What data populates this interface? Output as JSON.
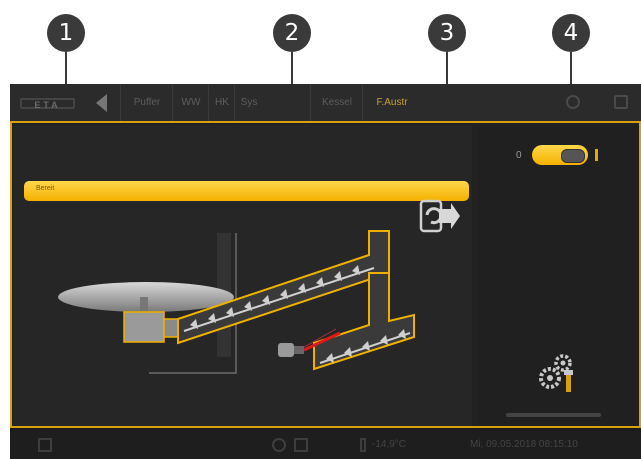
{
  "callouts": [
    "1",
    "2",
    "3",
    "4"
  ],
  "header": {
    "logo": "ETA",
    "tabs": [
      "Puffer",
      "WW",
      "HK",
      "Sys",
      "Kessel",
      "F.Austr"
    ],
    "active_tab": "F.Austr"
  },
  "main": {
    "status_text": "Bereit"
  },
  "toggle": {
    "label": "0"
  },
  "footer": {
    "temperature": "-14,9°C",
    "datetime": "Mi, 09.05.2018 08:15:10"
  },
  "colors": {
    "accent": "#f4b000",
    "background": "#1c1c1c",
    "callout": "#3a3a3a",
    "laser": "#e01818"
  },
  "icons": [
    "back-arrow-icon",
    "screw-direction-icon",
    "settings-gears-icon",
    "wrench-icon",
    "temperature-icon"
  ]
}
